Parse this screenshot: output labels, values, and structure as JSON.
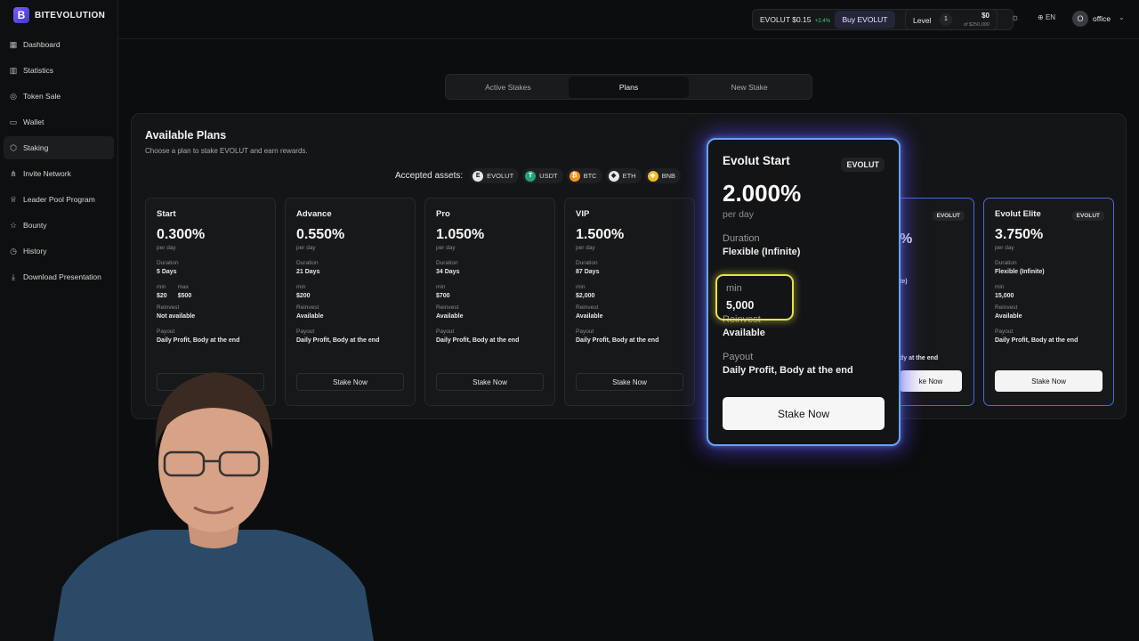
{
  "brand": {
    "name": "BITEVOLUTION"
  },
  "sidebar": {
    "items": [
      {
        "label": "Dashboard",
        "icon": "grid-icon"
      },
      {
        "label": "Statistics",
        "icon": "bar-chart-icon"
      },
      {
        "label": "Token Sale",
        "icon": "coin-icon"
      },
      {
        "label": "Wallet",
        "icon": "wallet-icon"
      },
      {
        "label": "Staking",
        "icon": "cube-icon",
        "active": true
      },
      {
        "label": "Invite Network",
        "icon": "share-icon"
      },
      {
        "label": "Leader Pool Program",
        "icon": "trophy-icon"
      },
      {
        "label": "Bounty",
        "icon": "star-icon"
      },
      {
        "label": "History",
        "icon": "history-icon"
      },
      {
        "label": "Download Presentation",
        "icon": "download-icon"
      }
    ]
  },
  "topbar": {
    "ticker": "EVOLUT $0.15",
    "change": "+2.4%",
    "buy_label": "Buy EVOLUT",
    "level_label": "Level",
    "level_value": "1",
    "level_amount": "$0",
    "level_sub": "of $250,000",
    "lang": "EN",
    "avatar_initial": "O",
    "user": "office"
  },
  "tabs": [
    "Active Stakes",
    "Plans",
    "New Stake"
  ],
  "panel": {
    "title": "Available Plans",
    "subtitle": "Choose a plan to stake EVOLUT and earn rewards.",
    "assets_label": "Accepted assets:",
    "assets": [
      {
        "name": "EVOLUT",
        "color": "#e9e9e9",
        "glyph": "E"
      },
      {
        "name": "USDT",
        "color": "#26a17b",
        "glyph": "T"
      },
      {
        "name": "BTC",
        "color": "#f7931a",
        "glyph": "₿"
      },
      {
        "name": "ETH",
        "color": "#e8e8e8",
        "glyph": "◆"
      },
      {
        "name": "BNB",
        "color": "#f3ba2f",
        "glyph": "◈"
      }
    ]
  },
  "plans": [
    {
      "name": "Start",
      "rate": "0.300%",
      "per": "per day",
      "duration_label": "Duration",
      "duration": "5 Days",
      "min_label": "min",
      "min": "$20",
      "max_label": "max",
      "max": "$500",
      "reinvest_label": "Reinvest",
      "reinvest": "Not available",
      "payout_label": "Payout",
      "payout": "Daily Profit, Body at the end",
      "button": "Stake Now"
    },
    {
      "name": "Advance",
      "rate": "0.550%",
      "per": "per day",
      "duration_label": "Duration",
      "duration": "21 Days",
      "min_label": "min",
      "min": "$200",
      "reinvest_label": "Reinvest",
      "reinvest": "Available",
      "payout_label": "Payout",
      "payout": "Daily Profit, Body at the end",
      "button": "Stake Now"
    },
    {
      "name": "Pro",
      "rate": "1.050%",
      "per": "per day",
      "duration_label": "Duration",
      "duration": "34 Days",
      "min_label": "min",
      "min": "$700",
      "reinvest_label": "Reinvest",
      "reinvest": "Available",
      "payout_label": "Payout",
      "payout": "Daily Profit, Body at the end",
      "button": "Stake Now"
    },
    {
      "name": "VIP",
      "rate": "1.500%",
      "per": "per day",
      "duration_label": "Duration",
      "duration": "87 Days",
      "min_label": "min",
      "min": "$2,000",
      "reinvest_label": "Reinvest",
      "reinvest": "Available",
      "payout_label": "Payout",
      "payout": "Daily Profit, Body at the end",
      "button": "Stake Now"
    }
  ],
  "partial_card": {
    "tag": "EVOLUT",
    "rate_tail": "%",
    "duration_tail": "te)",
    "payout_tail": "dy at the end",
    "button_tail": "ke Now"
  },
  "elite": {
    "name": "Evolut Elite",
    "tag": "EVOLUT",
    "rate": "3.750%",
    "per": "per day",
    "duration_label": "Duration",
    "duration": "Flexible (Infinite)",
    "min_label": "min",
    "min": "15,000",
    "reinvest_label": "Reinvest",
    "reinvest": "Available",
    "payout_label": "Payout",
    "payout": "Daily Profit, Body at the end",
    "button": "Stake Now"
  },
  "highlight": {
    "name": "Evolut Start",
    "tag": "EVOLUT",
    "rate": "2.000%",
    "per": "per day",
    "duration_label": "Duration",
    "duration": "Flexible (Infinite)",
    "min_label": "min",
    "min": "5,000",
    "reinvest_label": "Reinvest",
    "reinvest": "Available",
    "payout_label": "Payout",
    "payout": "Daily Profit, Body at the end",
    "button": "Stake Now"
  }
}
